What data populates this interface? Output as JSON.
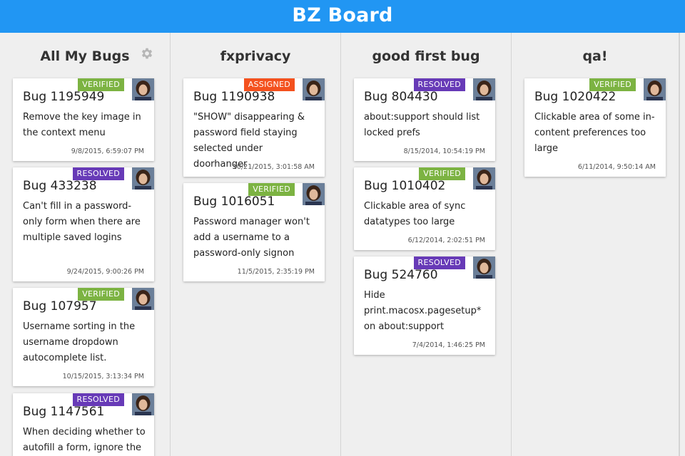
{
  "app": {
    "title": "BZ Board"
  },
  "colors": {
    "header": "#2196f3",
    "verified": "#7cb342",
    "resolved": "#673ab7",
    "assigned": "#f4511e"
  },
  "columns": [
    {
      "title": "All My Bugs",
      "has_settings": true,
      "settings_icon": "gear-icon",
      "cards": [
        {
          "status": "VERIFIED",
          "bug": "Bug 1195949",
          "summary": "Remove the key image in the context menu",
          "date": "9/8/2015, 6:59:07 PM"
        },
        {
          "status": "RESOLVED",
          "bug": "Bug 433238",
          "summary": "Can't fill in a password-only form when there are multiple saved logins",
          "date": "9/24/2015, 9:00:26 PM"
        },
        {
          "status": "VERIFIED",
          "bug": "Bug 107957",
          "summary": "Username sorting in the username dropdown autocomplete list.",
          "date": "10/15/2015, 3:13:34 PM"
        },
        {
          "status": "RESOLVED",
          "bug": "Bug 1147561",
          "summary": "When deciding whether to autofill a form, ignore the",
          "date": ""
        }
      ]
    },
    {
      "title": "fxprivacy",
      "cards": [
        {
          "status": "ASSIGNED",
          "bug": "Bug 1190938",
          "summary": "\"SHOW\" disappearing & password field staying selected under doorhanger",
          "date": "10/21/2015, 3:01:58 AM"
        },
        {
          "status": "VERIFIED",
          "bug": "Bug 1016051",
          "summary": "Password manager won't add a username to a password-only signon",
          "date": "11/5/2015, 2:35:19 PM"
        }
      ]
    },
    {
      "title": "good first bug",
      "cards": [
        {
          "status": "RESOLVED",
          "bug": "Bug 804430",
          "summary": "about:support should list locked prefs",
          "date": "8/15/2014, 10:54:19 PM"
        },
        {
          "status": "VERIFIED",
          "bug": "Bug 1010402",
          "summary": "Clickable area of sync datatypes too large",
          "date": "6/12/2014, 2:02:51 PM"
        },
        {
          "status": "RESOLVED",
          "bug": "Bug 524760",
          "summary": "Hide print.macosx.pagesetup* on about:support",
          "date": "7/4/2014, 1:46:25 PM"
        }
      ]
    },
    {
      "title": "qa!",
      "cards": [
        {
          "status": "VERIFIED",
          "bug": "Bug 1020422",
          "summary": "Clickable area of some in-content preferences too large",
          "date": "6/11/2014, 9:50:14 AM"
        }
      ]
    }
  ]
}
